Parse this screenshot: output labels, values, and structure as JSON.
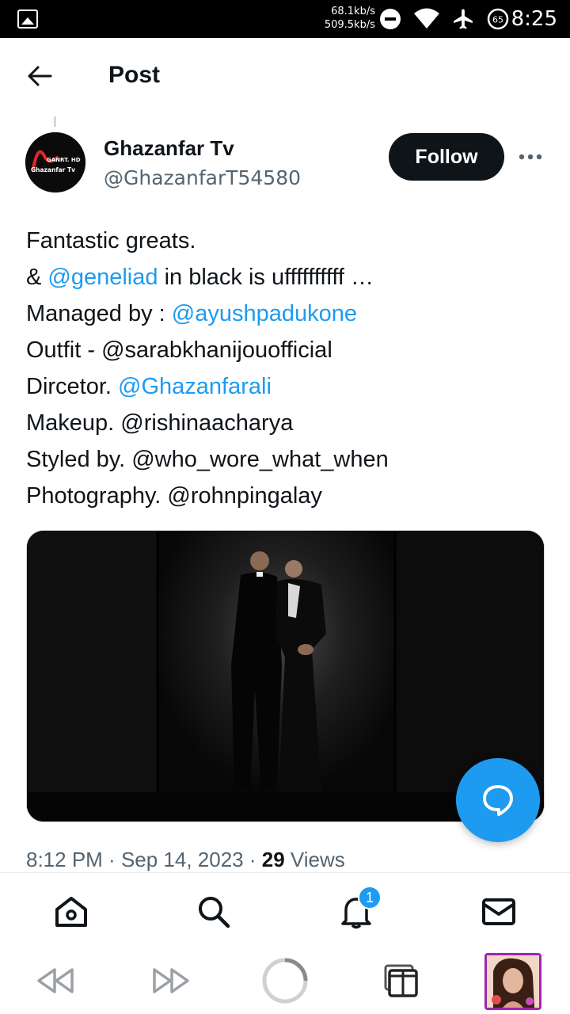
{
  "status_bar": {
    "speed_up": "68.1kb/s",
    "speed_down": "509.5kb/s",
    "battery": "65",
    "time": "8:25",
    "icons": [
      "image-icon",
      "dnd-icon",
      "wifi-icon",
      "airplane-icon",
      "battery-icon"
    ]
  },
  "header": {
    "title": "Post",
    "back_icon": "back-arrow-icon"
  },
  "author": {
    "name": "Ghazanfar Tv",
    "handle": "@GhazanfarT54580",
    "avatar_brand": "GANRT. HD",
    "avatar_name": "Ghazanfar Tv",
    "follow_label": "Follow"
  },
  "tweet": {
    "lines": [
      [
        {
          "text": "Fantastic greats."
        }
      ],
      [
        {
          "text": "& "
        },
        {
          "text": "@geneliad",
          "mention": true
        },
        {
          "text": " in black is uffffffffff …"
        }
      ],
      [
        {
          "text": "Managed by : "
        },
        {
          "text": "@ayushpadukone",
          "mention": true
        }
      ],
      [
        {
          "text": "Outfit - @sarabkhanijouofficial"
        }
      ],
      [
        {
          "text": "Dircetor. "
        },
        {
          "text": "@Ghazanfarali",
          "mention": true
        }
      ],
      [
        {
          "text": "Makeup. @rishinaacharya"
        }
      ],
      [
        {
          "text": "Styled by. @who_wore_what_when"
        }
      ],
      [
        {
          "text": "Photography. @rohnpingalay"
        }
      ]
    ]
  },
  "meta": {
    "time": "8:12 PM",
    "sep": " · ",
    "date": "Sep 14, 2023",
    "sep2": " · ",
    "views_count": "29",
    "views_label": " Views"
  },
  "nav": {
    "items": [
      "home-icon",
      "search-icon",
      "notifications-icon",
      "messages-icon"
    ],
    "notification_badge": "1"
  },
  "colors": {
    "accent": "#1d9bf0",
    "text": "#0f1419",
    "secondary": "#536471"
  }
}
